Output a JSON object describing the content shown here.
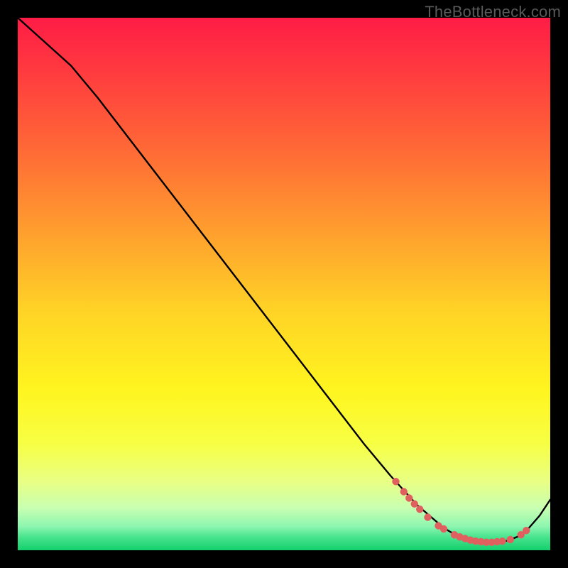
{
  "watermark": "TheBottleneck.com",
  "chart_data": {
    "type": "line",
    "title": "",
    "xlabel": "",
    "ylabel": "",
    "xlim": [
      0,
      100
    ],
    "ylim": [
      0,
      100
    ],
    "series": [
      {
        "name": "curve",
        "x": [
          0,
          5,
          10,
          15,
          20,
          25,
          30,
          35,
          40,
          45,
          50,
          55,
          60,
          65,
          70,
          75,
          80,
          82,
          84,
          86,
          88,
          90,
          92,
          94,
          96,
          98,
          100
        ],
        "y": [
          100,
          95.5,
          91,
          85,
          78.5,
          72,
          65.5,
          59,
          52.5,
          46,
          39.5,
          33,
          26.5,
          20,
          14,
          8.5,
          4.2,
          3.0,
          2.2,
          1.7,
          1.5,
          1.5,
          1.8,
          2.6,
          4.2,
          6.5,
          9.5
        ],
        "color": "#000000"
      }
    ],
    "markers": {
      "name": "dots",
      "color": "#e06060",
      "radius": 5.2,
      "points": [
        {
          "x": 71.0,
          "y": 12.9
        },
        {
          "x": 72.5,
          "y": 11.0
        },
        {
          "x": 73.5,
          "y": 9.8
        },
        {
          "x": 74.5,
          "y": 8.7
        },
        {
          "x": 75.5,
          "y": 7.7
        },
        {
          "x": 77.0,
          "y": 6.2
        },
        {
          "x": 79.0,
          "y": 4.6
        },
        {
          "x": 80.0,
          "y": 4.0
        },
        {
          "x": 82.0,
          "y": 2.9
        },
        {
          "x": 83.0,
          "y": 2.5
        },
        {
          "x": 84.0,
          "y": 2.2
        },
        {
          "x": 85.0,
          "y": 1.9
        },
        {
          "x": 86.0,
          "y": 1.7
        },
        {
          "x": 87.0,
          "y": 1.6
        },
        {
          "x": 88.0,
          "y": 1.5
        },
        {
          "x": 89.0,
          "y": 1.5
        },
        {
          "x": 90.0,
          "y": 1.6
        },
        {
          "x": 91.0,
          "y": 1.7
        },
        {
          "x": 92.5,
          "y": 2.0
        },
        {
          "x": 94.5,
          "y": 2.9
        },
        {
          "x": 95.5,
          "y": 3.7
        }
      ]
    },
    "background": {
      "type": "vertical-gradient",
      "stops": [
        {
          "pos": 0.0,
          "color": "#ff1c46"
        },
        {
          "pos": 0.1,
          "color": "#ff3a3f"
        },
        {
          "pos": 0.25,
          "color": "#ff6a36"
        },
        {
          "pos": 0.4,
          "color": "#ff9e2e"
        },
        {
          "pos": 0.55,
          "color": "#ffd326"
        },
        {
          "pos": 0.7,
          "color": "#fff51f"
        },
        {
          "pos": 0.8,
          "color": "#f7ff44"
        },
        {
          "pos": 0.87,
          "color": "#e9ff83"
        },
        {
          "pos": 0.92,
          "color": "#c9ffb1"
        },
        {
          "pos": 0.955,
          "color": "#8ef6b0"
        },
        {
          "pos": 0.975,
          "color": "#49e48f"
        },
        {
          "pos": 1.0,
          "color": "#14cf6b"
        }
      ]
    }
  }
}
